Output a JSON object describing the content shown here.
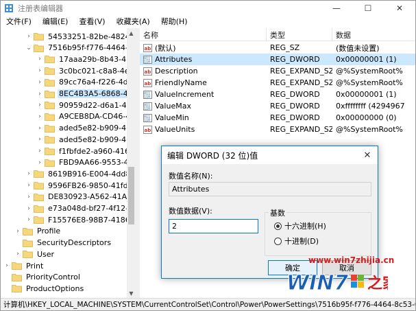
{
  "window": {
    "title": "注册表编辑器",
    "controls": {
      "minimize": "—",
      "maximize": "☐",
      "close": "✕"
    }
  },
  "menu": [
    "文件(F)",
    "编辑(E)",
    "查看(V)",
    "收藏夹(A)",
    "帮助(H)"
  ],
  "tree": {
    "items": [
      {
        "label": "54533251-82be-4824-96c",
        "level": 1,
        "arrow": "›"
      },
      {
        "label": "7516b95f-f776-4464-8c53",
        "level": 1,
        "arrow": "⌄"
      },
      {
        "label": "17aaa29b-8b43-4b94",
        "level": 2,
        "arrow": "›"
      },
      {
        "label": "3c0bc021-c8a8-4e07-a",
        "level": 2,
        "arrow": "›"
      },
      {
        "label": "89cc76a4-f226-4d4b-a",
        "level": 2,
        "arrow": "›"
      },
      {
        "label": "8EC4B3A5-6868-48c2-",
        "level": 2,
        "arrow": "›",
        "selected": true
      },
      {
        "label": "90959d22-d6a1-49b9-",
        "level": 2,
        "arrow": "›"
      },
      {
        "label": "A9CEB8DA-CD46-44FB",
        "level": 2,
        "arrow": "›"
      },
      {
        "label": "aded5e82-b909-4619-",
        "level": 2,
        "arrow": "›"
      },
      {
        "label": "aded5e82-b909-4619-",
        "level": 2,
        "arrow": "›"
      },
      {
        "label": "f1fbfde2-a960-4165-9",
        "level": 2,
        "arrow": "›"
      },
      {
        "label": "FBD9AA66-9553-4097",
        "level": 2,
        "arrow": "›"
      },
      {
        "label": "8619B916-E004-4dd8-9B",
        "level": 1,
        "arrow": "›"
      },
      {
        "label": "9596FB26-9850-41fd-AC3",
        "level": 1,
        "arrow": "›"
      },
      {
        "label": "DE830923-A562-41AF-A0",
        "level": 1,
        "arrow": "›"
      },
      {
        "label": "e73a048d-bf27-4f12-973",
        "level": 1,
        "arrow": "›"
      },
      {
        "label": "F15576E8-98B7-4186-B94",
        "level": 1,
        "arrow": "›"
      },
      {
        "label": "Profile",
        "level": 0,
        "arrow": "›"
      },
      {
        "label": "SecurityDescriptors",
        "level": 0,
        "arrow": ""
      },
      {
        "label": "User",
        "level": 0,
        "arrow": "›"
      },
      {
        "label": "Print",
        "level": -1,
        "arrow": "›"
      },
      {
        "label": "PriorityControl",
        "level": -1,
        "arrow": ""
      },
      {
        "label": "ProductOptions",
        "level": -1,
        "arrow": ""
      }
    ]
  },
  "list": {
    "headers": {
      "name": "名称",
      "type": "类型",
      "data": "数据"
    },
    "rows": [
      {
        "icon": "string-value-icon",
        "name": "(默认)",
        "type": "REG_SZ",
        "data": "(数值未设置)"
      },
      {
        "icon": "binary-value-icon",
        "name": "Attributes",
        "type": "REG_DWORD",
        "data": "0x00000001 (1)",
        "selected": true
      },
      {
        "icon": "string-value-icon",
        "name": "Description",
        "type": "REG_EXPAND_SZ",
        "data": "@%SystemRoot%"
      },
      {
        "icon": "string-value-icon",
        "name": "FriendlyName",
        "type": "REG_EXPAND_SZ",
        "data": "@%SystemRoot%"
      },
      {
        "icon": "binary-value-icon",
        "name": "ValueIncrement",
        "type": "REG_DWORD",
        "data": "0x00000001 (1)"
      },
      {
        "icon": "binary-value-icon",
        "name": "ValueMax",
        "type": "REG_DWORD",
        "data": "0xffffffff (4294967"
      },
      {
        "icon": "binary-value-icon",
        "name": "ValueMin",
        "type": "REG_DWORD",
        "data": "0x00000000 (0)"
      },
      {
        "icon": "string-value-icon",
        "name": "ValueUnits",
        "type": "REG_EXPAND_SZ",
        "data": "@%SystemRoot%"
      }
    ]
  },
  "status": {
    "path": "计算机\\HKEY_LOCAL_MACHINE\\SYSTEM\\CurrentControlSet\\Control\\Power\\PowerSettings\\7516b95f-f776-4464-8c53-06167f"
  },
  "dialog": {
    "title": "编辑 DWORD (32 位)值",
    "close": "✕",
    "name_label": "数值名称(N):",
    "name_value": "Attributes",
    "data_label": "数值数据(V):",
    "data_value": "2",
    "base_label": "基数",
    "hex_label": "十六进制(H)",
    "dec_label": "十进制(D)",
    "base_selected": "hex",
    "ok_label": "确定",
    "cancel_label": "取消"
  },
  "watermark": {
    "url": "www.win7zhijia.cn",
    "logo_text": "WIN7",
    "logo_suffix": "之家"
  },
  "colors": {
    "accent": "#0078d7",
    "selection": "#cce8ff",
    "folder": "#f6d77a",
    "watermark": "#d31d1d"
  }
}
